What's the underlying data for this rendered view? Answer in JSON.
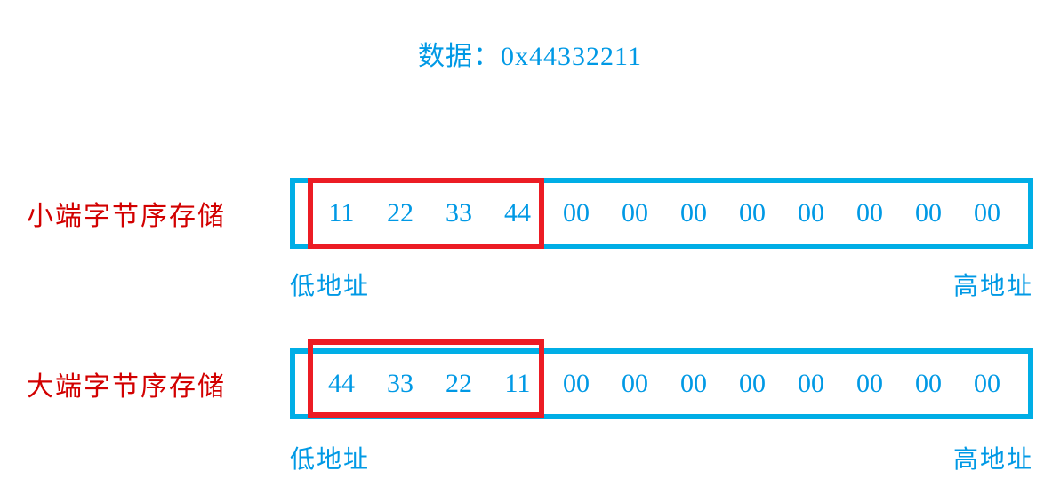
{
  "title": "数据：0x44332211",
  "rows": [
    {
      "label": "小端字节序存储",
      "bytes": [
        "11",
        "22",
        "33",
        "44",
        "00",
        "00",
        "00",
        "00",
        "00",
        "00",
        "00",
        "00"
      ],
      "lowAddr": "低地址",
      "highAddr": "高地址"
    },
    {
      "label": "大端字节序存储",
      "bytes": [
        "44",
        "33",
        "22",
        "11",
        "00",
        "00",
        "00",
        "00",
        "00",
        "00",
        "00",
        "00"
      ],
      "lowAddr": "低地址",
      "highAddr": "高地址"
    }
  ]
}
